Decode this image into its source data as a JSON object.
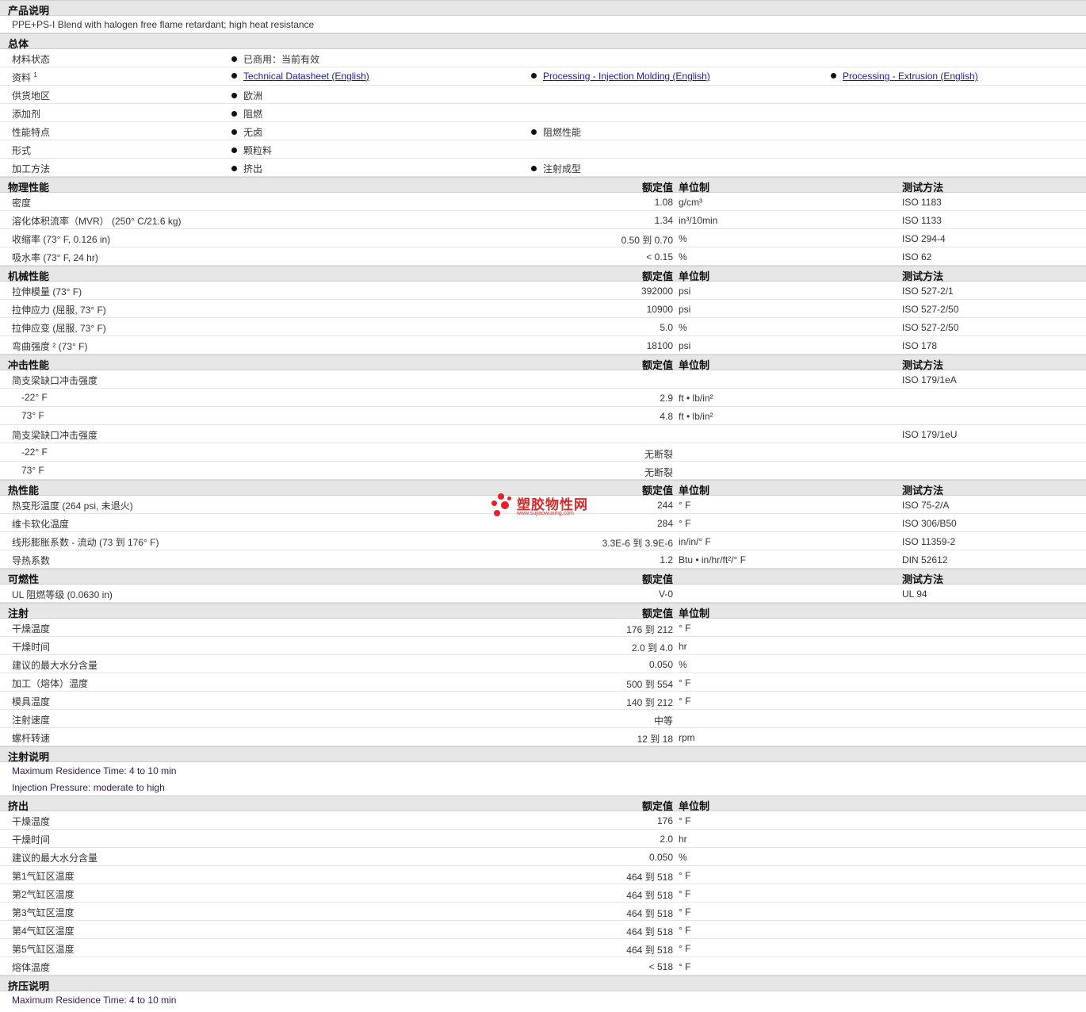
{
  "watermark": {
    "text": "塑胶物性网",
    "url": "www.sujiaowuxing.com"
  },
  "product": {
    "header": "产品说明",
    "description": "PPE+PS-I Blend with halogen free flame retardant; high heat resistance"
  },
  "general": {
    "header": "总体",
    "rows": [
      {
        "label": "材料状态",
        "items": [
          "已商用：当前有效"
        ]
      },
      {
        "label": "资料",
        "sup": "1",
        "links": [
          "Technical Datasheet (English)",
          "Processing - Injection Molding (English)",
          "Processing - Extrusion (English)"
        ]
      },
      {
        "label": "供货地区",
        "items": [
          "欧洲"
        ]
      },
      {
        "label": "添加剂",
        "items": [
          "阻燃"
        ]
      },
      {
        "label": "性能特点",
        "items": [
          "无卤",
          "阻燃性能"
        ]
      },
      {
        "label": "形式",
        "items": [
          "颗粒料"
        ]
      },
      {
        "label": "加工方法",
        "items": [
          "挤出",
          "注射成型"
        ]
      }
    ]
  },
  "columns": {
    "value": "额定值",
    "unit": "单位制",
    "method": "测试方法"
  },
  "physical": {
    "header": "物理性能",
    "rows": [
      {
        "label": "密度",
        "value": "1.08",
        "unit": "g/cm³",
        "method": "ISO 1183"
      },
      {
        "label": "溶化体积流率（MVR） (250° C/21.6 kg)",
        "value": "1.34",
        "unit": "in³/10min",
        "method": "ISO 1133"
      },
      {
        "label": "收缩率 (73° F, 0.126 in)",
        "value": "0.50 到  0.70",
        "unit": "%",
        "method": "ISO 294-4"
      },
      {
        "label": "吸水率 (73° F, 24 hr)",
        "value": "< 0.15",
        "unit": "%",
        "method": "ISO 62"
      }
    ]
  },
  "mechanical": {
    "header": "机械性能",
    "rows": [
      {
        "label": "拉伸模量 (73° F)",
        "value": "392000",
        "unit": "psi",
        "method": "ISO 527-2/1"
      },
      {
        "label": "拉伸应力 (屈服, 73° F)",
        "value": "10900",
        "unit": "psi",
        "method": "ISO 527-2/50"
      },
      {
        "label": "拉伸应变 (屈服, 73° F)",
        "value": "5.0",
        "unit": "%",
        "method": "ISO 527-2/50"
      },
      {
        "label": "弯曲强度 ² (73° F)",
        "value": "18100",
        "unit": "psi",
        "method": "ISO 178"
      }
    ]
  },
  "impact": {
    "header": "冲击性能",
    "rows": [
      {
        "label": "简支梁缺口冲击强度",
        "sub": false,
        "value": "",
        "unit": "",
        "method": "ISO 179/1eA"
      },
      {
        "label": "-22° F",
        "sub": true,
        "value": "2.9",
        "unit": "ft • lb/in²",
        "method": ""
      },
      {
        "label": "73° F",
        "sub": true,
        "value": "4.8",
        "unit": "ft • lb/in²",
        "method": ""
      },
      {
        "label": "简支梁缺口冲击强度",
        "sub": false,
        "value": "",
        "unit": "",
        "method": "ISO 179/1eU"
      },
      {
        "label": "-22° F",
        "sub": true,
        "value": "无断裂",
        "unit": "",
        "method": ""
      },
      {
        "label": "73° F",
        "sub": true,
        "value": "无断裂",
        "unit": "",
        "method": ""
      }
    ]
  },
  "thermal": {
    "header": "热性能",
    "rows": [
      {
        "label": "热变形温度 (264 psi, 未退火)",
        "value": "244",
        "unit": "° F",
        "method": "ISO 75-2/A"
      },
      {
        "label": "维卡软化温度",
        "value": "284",
        "unit": "° F",
        "method": "ISO 306/B50"
      },
      {
        "label": "线形膨胀系数 - 流动 (73 到  176° F)",
        "value": "3.3E-6 到  3.9E-6",
        "unit": "in/in/° F",
        "method": "ISO 11359-2"
      },
      {
        "label": "导热系数",
        "value": "1.2",
        "unit": "Btu • in/hr/ft²/° F",
        "method": "DIN 52612"
      }
    ]
  },
  "flammability": {
    "header": "可燃性",
    "rows": [
      {
        "label": "UL 阻燃等级 (0.0630 in)",
        "value": "V-0",
        "unit": "",
        "method": "UL 94"
      }
    ]
  },
  "injection": {
    "header": "注射",
    "rows": [
      {
        "label": "干燥温度",
        "value": "176 到  212",
        "unit": "° F"
      },
      {
        "label": "干燥时间",
        "value": "2.0 到  4.0",
        "unit": "hr"
      },
      {
        "label": "建议的最大水分含量",
        "value": "0.050",
        "unit": "%"
      },
      {
        "label": "加工（熔体）温度",
        "value": "500 到  554",
        "unit": "° F"
      },
      {
        "label": "模具温度",
        "value": "140 到  212",
        "unit": "° F"
      },
      {
        "label": "注射速度",
        "value": "中等",
        "unit": ""
      },
      {
        "label": "螺杆转速",
        "value": "12 到  18",
        "unit": "rpm"
      }
    ]
  },
  "injection_notes": {
    "header": "注射说明",
    "lines": [
      "Maximum Residence Time: 4 to 10 min",
      "Injection Pressure: moderate to high"
    ]
  },
  "extrusion": {
    "header": "挤出",
    "rows": [
      {
        "label": "干燥温度",
        "value": "176",
        "unit": "° F"
      },
      {
        "label": "干燥时间",
        "value": "2.0",
        "unit": "hr"
      },
      {
        "label": "建议的最大水分含量",
        "value": "0.050",
        "unit": "%"
      },
      {
        "label": "第1气缸区温度",
        "value": "464 到  518",
        "unit": "° F"
      },
      {
        "label": "第2气缸区温度",
        "value": "464 到  518",
        "unit": "° F"
      },
      {
        "label": "第3气缸区温度",
        "value": "464 到  518",
        "unit": "° F"
      },
      {
        "label": "第4气缸区温度",
        "value": "464 到  518",
        "unit": "° F"
      },
      {
        "label": "第5气缸区温度",
        "value": "464 到  518",
        "unit": "° F"
      },
      {
        "label": "熔体温度",
        "value": "< 518",
        "unit": "° F"
      }
    ]
  },
  "extrusion_notes": {
    "header": "挤压说明",
    "lines": [
      "Maximum Residence Time: 4 to 10 min"
    ]
  }
}
